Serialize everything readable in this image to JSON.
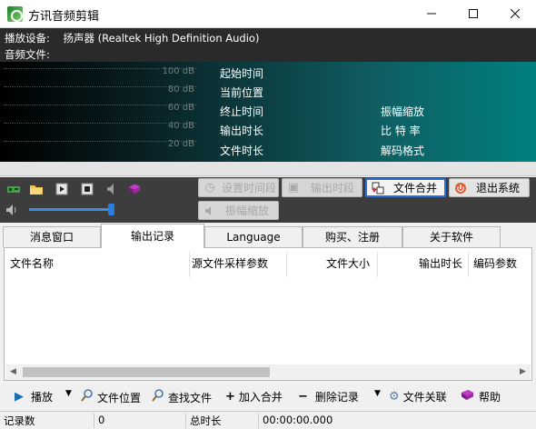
{
  "window": {
    "title": "方讯音频剪辑",
    "min_icon": "minimize-icon",
    "max_icon": "maximize-icon",
    "close_icon": "close-icon"
  },
  "display": {
    "device_label": "播放设备:",
    "device_value": "扬声器 (Realtek High Definition Audio)",
    "file_label": "音频文件:",
    "db_levels": [
      "100 dB",
      "80 dB",
      "60 dB",
      "40 dB",
      "20 dB"
    ],
    "fields_left": [
      "起始时间",
      "当前位置",
      "终止时间",
      "输出时长",
      "文件时长"
    ],
    "fields_right": [
      "振幅缩放",
      "比 特 率",
      "解码格式"
    ]
  },
  "toolbar": {
    "set_segment": "设置时间段",
    "output_segment": "输出时段",
    "merge_files": "文件合并",
    "exit": "退出系统",
    "amp_scale": "振幅缩放",
    "volume_level": 0.95
  },
  "tabs": [
    "消息窗口",
    "输出记录",
    "Language",
    "购买、注册",
    "关于软件"
  ],
  "active_tab": 1,
  "table": {
    "columns": [
      "文件名称",
      "源文件采样参数",
      "文件大小",
      "输出时长",
      "编码参数"
    ]
  },
  "bottom": {
    "play": "播放",
    "file_location": "文件位置",
    "find_file": "查找文件",
    "add_merge": "加入合并",
    "delete_record": "删除记录",
    "file_assoc": "文件关联",
    "help": "帮助"
  },
  "status": {
    "count_label": "记录数",
    "count_value": "0",
    "total_label": "总时长",
    "total_value": "00:00:00.000"
  },
  "colors": {
    "accent": "#2a6fd6",
    "display_teal": "#008080"
  }
}
